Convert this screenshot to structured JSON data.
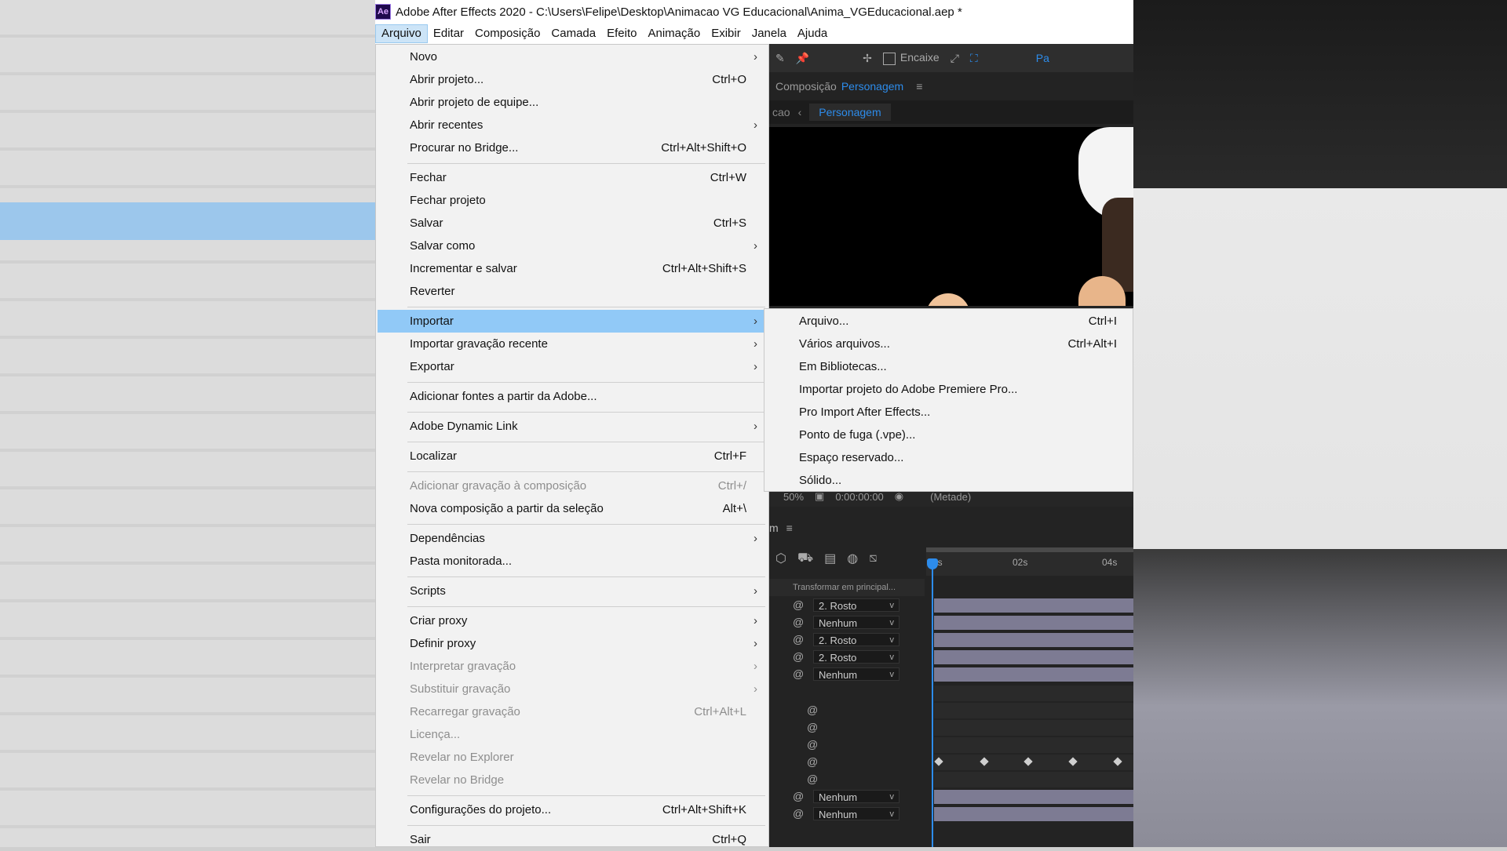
{
  "window": {
    "logo": "Ae",
    "title": "Adobe After Effects 2020 - C:\\Users\\Felipe\\Desktop\\Animacao VG Educacional\\Anima_VGEducacional.aep *"
  },
  "menubar": [
    "Arquivo",
    "Editar",
    "Composição",
    "Camada",
    "Efeito",
    "Animação",
    "Exibir",
    "Janela",
    "Ajuda"
  ],
  "toolbar": {
    "snap_label": "Encaixe",
    "workspace_partial": "Pa"
  },
  "composition_panel": {
    "prefix": "Composição",
    "name": "Personagem",
    "crumb_prev": "cao",
    "crumb_current": "Personagem"
  },
  "viewer_footer": {
    "zoom": "50%",
    "timecode": "0:00:00:00",
    "resolution": "(Metade)"
  },
  "timeline": {
    "tab_partial": "m",
    "ruler": [
      "0s",
      "02s",
      "04s"
    ],
    "column_header": "Transformar em principal...",
    "parent_values": [
      "2. Rosto",
      "Nenhum",
      "2. Rosto",
      "2. Rosto",
      "Nenhum",
      "Nenhum",
      "Nenhum"
    ]
  },
  "file_menu": {
    "items": [
      {
        "label": "Novo",
        "shortcut": "",
        "submenu": true,
        "disabled": false
      },
      {
        "label": "Abrir projeto...",
        "shortcut": "Ctrl+O",
        "submenu": false,
        "disabled": false
      },
      {
        "label": "Abrir projeto de equipe...",
        "shortcut": "",
        "submenu": false,
        "disabled": false
      },
      {
        "label": "Abrir recentes",
        "shortcut": "",
        "submenu": true,
        "disabled": false
      },
      {
        "label": "Procurar no Bridge...",
        "shortcut": "Ctrl+Alt+Shift+O",
        "submenu": false,
        "disabled": false
      },
      {
        "label": "Fechar",
        "shortcut": "Ctrl+W",
        "submenu": false,
        "disabled": false
      },
      {
        "label": "Fechar projeto",
        "shortcut": "",
        "submenu": false,
        "disabled": false
      },
      {
        "label": "Salvar",
        "shortcut": "Ctrl+S",
        "submenu": false,
        "disabled": false
      },
      {
        "label": "Salvar como",
        "shortcut": "",
        "submenu": true,
        "disabled": false
      },
      {
        "label": "Incrementar e salvar",
        "shortcut": "Ctrl+Alt+Shift+S",
        "submenu": false,
        "disabled": false
      },
      {
        "label": "Reverter",
        "shortcut": "",
        "submenu": false,
        "disabled": false
      },
      {
        "label": "Importar",
        "shortcut": "",
        "submenu": true,
        "disabled": false
      },
      {
        "label": "Importar gravação recente",
        "shortcut": "",
        "submenu": true,
        "disabled": false
      },
      {
        "label": "Exportar",
        "shortcut": "",
        "submenu": true,
        "disabled": false
      },
      {
        "label": "Adicionar fontes a partir da Adobe...",
        "shortcut": "",
        "submenu": false,
        "disabled": false
      },
      {
        "label": "Adobe Dynamic Link",
        "shortcut": "",
        "submenu": true,
        "disabled": false
      },
      {
        "label": "Localizar",
        "shortcut": "Ctrl+F",
        "submenu": false,
        "disabled": false
      },
      {
        "label": "Adicionar gravação à composição",
        "shortcut": "Ctrl+/",
        "submenu": false,
        "disabled": true
      },
      {
        "label": "Nova composição a partir da seleção",
        "shortcut": "Alt+\\",
        "submenu": false,
        "disabled": false
      },
      {
        "label": "Dependências",
        "shortcut": "",
        "submenu": true,
        "disabled": false
      },
      {
        "label": "Pasta monitorada...",
        "shortcut": "",
        "submenu": false,
        "disabled": false
      },
      {
        "label": "Scripts",
        "shortcut": "",
        "submenu": true,
        "disabled": false
      },
      {
        "label": "Criar proxy",
        "shortcut": "",
        "submenu": true,
        "disabled": false
      },
      {
        "label": "Definir proxy",
        "shortcut": "",
        "submenu": true,
        "disabled": false
      },
      {
        "label": "Interpretar gravação",
        "shortcut": "",
        "submenu": true,
        "disabled": true
      },
      {
        "label": "Substituir gravação",
        "shortcut": "",
        "submenu": true,
        "disabled": true
      },
      {
        "label": "Recarregar gravação",
        "shortcut": "Ctrl+Alt+L",
        "submenu": false,
        "disabled": true
      },
      {
        "label": "Licença...",
        "shortcut": "",
        "submenu": false,
        "disabled": true
      },
      {
        "label": "Revelar no Explorer",
        "shortcut": "",
        "submenu": false,
        "disabled": true
      },
      {
        "label": "Revelar no Bridge",
        "shortcut": "",
        "submenu": false,
        "disabled": true
      },
      {
        "label": "Configurações do projeto...",
        "shortcut": "Ctrl+Alt+Shift+K",
        "submenu": false,
        "disabled": false
      },
      {
        "label": "Sair",
        "shortcut": "Ctrl+Q",
        "submenu": false,
        "disabled": false
      }
    ],
    "highlighted": "Importar"
  },
  "import_submenu": {
    "items": [
      {
        "label": "Arquivo...",
        "shortcut": "Ctrl+I"
      },
      {
        "label": "Vários arquivos...",
        "shortcut": "Ctrl+Alt+I"
      },
      {
        "label": "Em Bibliotecas...",
        "shortcut": ""
      },
      {
        "label": "Importar projeto do Adobe Premiere Pro...",
        "shortcut": ""
      },
      {
        "label": "Pro Import After Effects...",
        "shortcut": ""
      },
      {
        "label": "Ponto de fuga (.vpe)...",
        "shortcut": ""
      },
      {
        "label": "Espaço reservado...",
        "shortcut": ""
      },
      {
        "label": "Sólido...",
        "shortcut": ""
      }
    ]
  },
  "colors": {
    "highlight": "#91c9f7",
    "ae_blue": "#2d8ceb",
    "layer_bar": "#7d7b93"
  }
}
